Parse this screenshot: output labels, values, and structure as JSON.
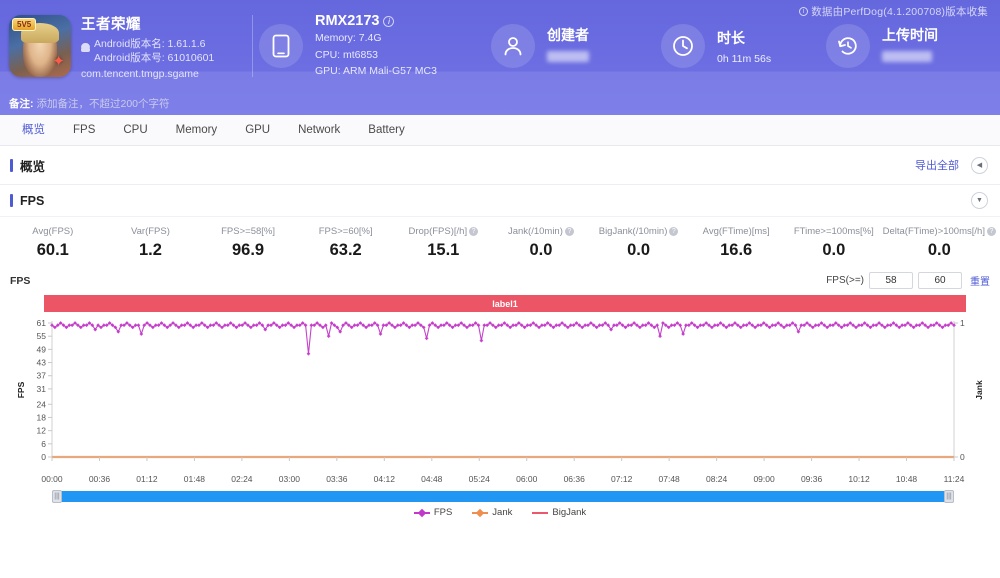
{
  "header": {
    "perfdog_note": "数据由PerfDog(4.1.200708)版本收集",
    "app": {
      "name": "王者荣耀",
      "version_name": "Android版本名: 1.61.1.6",
      "version_code": "Android版本号: 61010601",
      "package": "com.tencent.tmgp.sgame"
    },
    "device": {
      "model": "RMX2173",
      "memory": "Memory: 7.4G",
      "cpu": "CPU: mt6853",
      "gpu": "GPU: ARM Mali-G57 MC3"
    },
    "creator": {
      "title": "创建者",
      "value": ""
    },
    "duration": {
      "title": "时长",
      "value": "0h 11m 56s"
    },
    "upload_time": {
      "title": "上传时间",
      "value": ""
    },
    "remark": {
      "label": "备注:",
      "placeholder": "添加备注，不超过200个字符"
    }
  },
  "tabs": [
    {
      "label": "概览",
      "active": true
    },
    {
      "label": "FPS",
      "active": false
    },
    {
      "label": "CPU",
      "active": false
    },
    {
      "label": "Memory",
      "active": false
    },
    {
      "label": "GPU",
      "active": false
    },
    {
      "label": "Network",
      "active": false
    },
    {
      "label": "Battery",
      "active": false
    }
  ],
  "overview": {
    "title": "概览",
    "export_label": "导出全部"
  },
  "fps_section": {
    "title": "FPS",
    "metrics": [
      {
        "label": "Avg(FPS)",
        "value": "60.1",
        "help": false
      },
      {
        "label": "Var(FPS)",
        "value": "1.2",
        "help": false
      },
      {
        "label": "FPS>=58[%]",
        "value": "96.9",
        "help": false
      },
      {
        "label": "FPS>=60[%]",
        "value": "63.2",
        "help": false
      },
      {
        "label": "Drop(FPS)[/h]",
        "value": "15.1",
        "help": true
      },
      {
        "label": "Jank(/10min)",
        "value": "0.0",
        "help": true
      },
      {
        "label": "BigJank(/10min)",
        "value": "0.0",
        "help": true
      },
      {
        "label": "Avg(FTime)[ms]",
        "value": "16.6",
        "help": false
      },
      {
        "label": "FTime>=100ms[%]",
        "value": "0.0",
        "help": false
      },
      {
        "label": "Delta(FTime)>100ms[/h]",
        "value": "0.0",
        "help": true
      }
    ]
  },
  "chart_controls": {
    "chart_name": "FPS",
    "fps_threshold_label": "FPS(>=)",
    "threshold_1": "58",
    "threshold_2": "60",
    "reset_label": "重置"
  },
  "chart_data": {
    "type": "line",
    "title": "FPS",
    "label_bar": "label1",
    "xlabel": "",
    "ylabel": "FPS",
    "y2label": "Jank",
    "ylim": [
      0,
      61
    ],
    "y2lim": [
      0,
      1
    ],
    "yticks": [
      0,
      6,
      12,
      18,
      24,
      31,
      37,
      43,
      49,
      55,
      61
    ],
    "y2ticks": [
      0,
      1
    ],
    "xticks": [
      "00:00",
      "00:36",
      "01:12",
      "01:48",
      "02:24",
      "03:00",
      "03:36",
      "04:12",
      "04:48",
      "05:24",
      "06:00",
      "06:36",
      "07:12",
      "07:48",
      "08:24",
      "09:00",
      "09:36",
      "10:12",
      "10:48",
      "11:24"
    ],
    "grid": false,
    "legend_position": "bottom",
    "series": [
      {
        "name": "FPS",
        "color": "#c238c8",
        "axis": "left",
        "values": [
          60,
          59,
          60,
          61,
          60,
          59,
          60,
          60,
          61,
          60,
          59,
          60,
          60,
          61,
          60,
          58,
          60,
          59,
          60,
          60,
          61,
          60,
          59,
          57,
          60,
          60,
          61,
          60,
          59,
          60,
          60,
          56,
          60,
          61,
          60,
          59,
          60,
          60,
          61,
          60,
          59,
          60,
          61,
          60,
          59,
          60,
          60,
          61,
          60,
          59,
          60,
          60,
          61,
          60,
          59,
          60,
          60,
          61,
          60,
          59,
          60,
          60,
          61,
          60,
          59,
          60,
          60,
          61,
          60,
          59,
          60,
          60,
          61,
          60,
          58,
          60,
          60,
          61,
          60,
          59,
          60,
          60,
          61,
          60,
          59,
          60,
          60,
          61,
          60,
          47,
          60,
          60,
          61,
          60,
          59,
          60,
          55,
          61,
          60,
          59,
          57,
          60,
          61,
          60,
          59,
          60,
          60,
          61,
          60,
          59,
          60,
          60,
          61,
          60,
          56,
          60,
          60,
          61,
          60,
          59,
          60,
          60,
          61,
          60,
          59,
          60,
          60,
          61,
          60,
          59,
          54,
          60,
          61,
          60,
          59,
          60,
          60,
          61,
          60,
          59,
          60,
          60,
          61,
          60,
          59,
          60,
          60,
          61,
          60,
          53,
          60,
          60,
          61,
          60,
          59,
          60,
          60,
          61,
          60,
          59,
          60,
          60,
          61,
          60,
          59,
          60,
          60,
          61,
          60,
          59,
          60,
          60,
          61,
          60,
          59,
          60,
          60,
          61,
          60,
          59,
          60,
          60,
          61,
          60,
          59,
          60,
          60,
          61,
          60,
          59,
          60,
          60,
          61,
          60,
          58,
          60,
          60,
          61,
          60,
          59,
          60,
          60,
          61,
          60,
          59,
          60,
          60,
          61,
          60,
          59,
          60,
          55,
          61,
          60,
          59,
          60,
          60,
          61,
          60,
          56,
          60,
          60,
          61,
          60,
          59,
          60,
          60,
          61,
          60,
          59,
          60,
          60,
          61,
          60,
          59,
          60,
          60,
          61,
          60,
          59,
          60,
          60,
          61,
          60,
          59,
          60,
          60,
          61,
          60,
          59,
          60,
          60,
          61,
          60,
          59,
          60,
          60,
          61,
          60,
          57,
          60,
          60,
          61,
          60,
          59,
          60,
          60,
          61,
          60,
          59,
          60,
          60,
          61,
          60,
          59,
          60,
          60,
          61,
          60,
          59,
          60,
          60,
          61,
          60,
          59,
          60,
          60,
          61,
          60,
          59,
          60,
          60,
          61,
          60,
          59,
          60,
          60,
          61,
          60,
          59,
          60,
          60,
          61,
          60,
          59,
          60,
          60,
          61,
          60,
          59,
          60,
          60,
          61,
          60
        ]
      },
      {
        "name": "Jank",
        "color": "#ef8e4e",
        "axis": "right",
        "values": []
      },
      {
        "name": "BigJank",
        "color": "#e9596b",
        "axis": "right",
        "values": []
      }
    ],
    "legend": [
      "FPS",
      "Jank",
      "BigJank"
    ]
  }
}
